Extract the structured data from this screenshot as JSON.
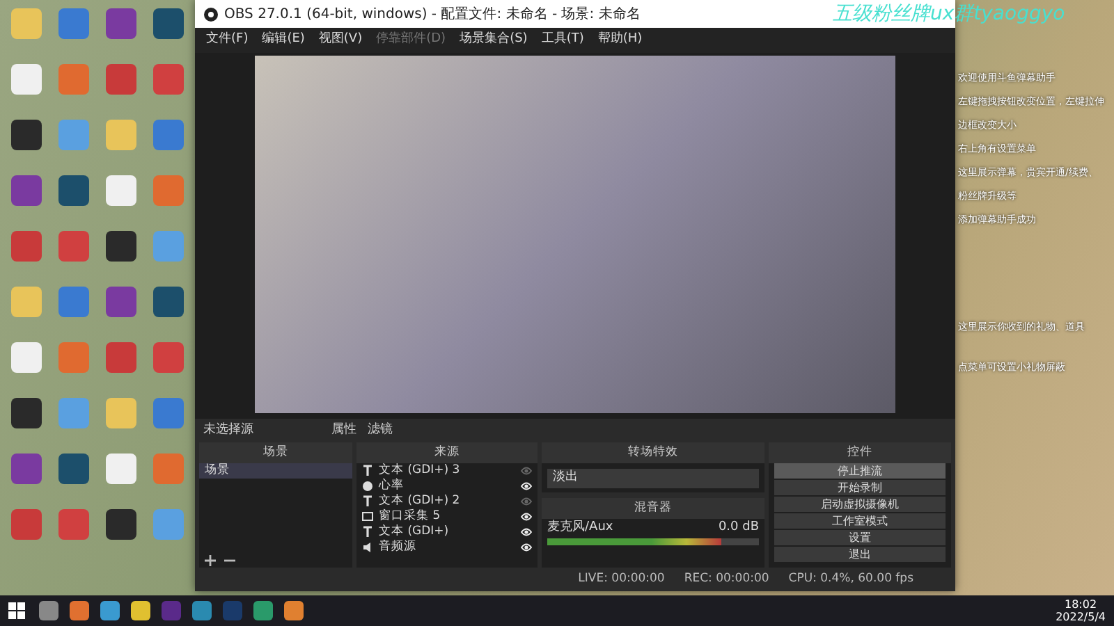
{
  "obs_window": {
    "title": "OBS 27.0.1 (64-bit, windows) - 配置文件: 未命名 - 场景: 未命名",
    "menu": [
      {
        "label": "文件(F)",
        "disabled": false
      },
      {
        "label": "编辑(E)",
        "disabled": false
      },
      {
        "label": "视图(V)",
        "disabled": false
      },
      {
        "label": "停靠部件(D)",
        "disabled": true
      },
      {
        "label": "场景集合(S)",
        "disabled": false
      },
      {
        "label": "工具(T)",
        "disabled": false
      },
      {
        "label": "帮助(H)",
        "disabled": false
      }
    ],
    "source_toolbar": {
      "label": "未选择源",
      "buttons": [
        "属性",
        "滤镜"
      ]
    },
    "scenes": {
      "title": "场景",
      "items": [
        {
          "label": "场景",
          "selected": true
        }
      ]
    },
    "sources": {
      "title": "来源",
      "items": [
        {
          "label": "文本 (GDI+) 3",
          "kind": "text",
          "visible": false
        },
        {
          "label": "心率",
          "kind": "media",
          "visible": true
        },
        {
          "label": "文本 (GDI+) 2",
          "kind": "text",
          "visible": false
        },
        {
          "label": "窗口采集 5",
          "kind": "window",
          "visible": true
        },
        {
          "label": "文本 (GDI+)",
          "kind": "text",
          "visible": true
        },
        {
          "label": "音频源",
          "kind": "audio",
          "visible": true
        }
      ]
    },
    "transitions": {
      "title": "转场特效",
      "value": "淡出"
    },
    "mixer": {
      "title": "混音器",
      "channel": "麦克风/Aux",
      "reading": "0.0 dB",
      "level": 0.82
    },
    "controls": {
      "title": "控件",
      "buttons": [
        {
          "label": "停止推流",
          "selected": true
        },
        {
          "label": "开始录制",
          "selected": false
        },
        {
          "label": "启动虚拟摄像机",
          "selected": false
        },
        {
          "label": "工作室模式",
          "selected": false
        },
        {
          "label": "设置",
          "selected": false
        },
        {
          "label": "退出",
          "selected": false
        }
      ]
    },
    "status_bar": [
      "LIVE: 00:00:00",
      "REC: 00:00:00",
      "CPU: 0.4%, 60.00 fps"
    ]
  },
  "overlay": {
    "banner": "五级粉丝牌ux群tyaoggyo",
    "lines": [
      "欢迎使用斗鱼弹幕助手",
      "左键拖拽按钮改变位置，左键拉伸",
      "边框改变大小",
      "右上角有设置菜单",
      "这里展示弹幕，贵宾开通/续费、",
      "粉丝牌升级等",
      "添加弹幕助手成功"
    ],
    "gift_lines": [
      "这里展示你收到的礼物、道具",
      "点菜单可设置小礼物屏蔽"
    ]
  },
  "taskbar": {
    "time": "18:02",
    "date": "2022/5/4"
  }
}
